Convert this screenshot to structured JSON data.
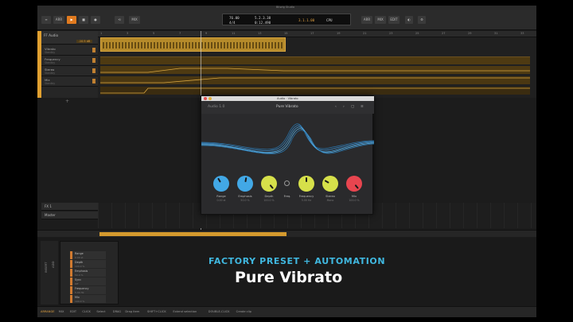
{
  "window": {
    "title": "Bitwig Studio"
  },
  "toolbar": {
    "buttons": [
      "≡",
      "ARR",
      "▶",
      "■",
      "●",
      "⟲",
      "MIX"
    ],
    "right_buttons": [
      "ARR",
      "MIX",
      "EDIT",
      "◐",
      "⚙"
    ]
  },
  "transport": {
    "tempo": "76.00",
    "signature": "4/4",
    "position": "5.2.3.38",
    "time": "0:12.490",
    "bar_readout": "3.1.1.00",
    "cpu": "CPU"
  },
  "ruler": {
    "ticks": [
      "1",
      "3",
      "5",
      "7",
      "9",
      "11",
      "13",
      "15",
      "17",
      "19",
      "21",
      "23",
      "25",
      "27",
      "29",
      "31",
      "33"
    ]
  },
  "tracks": {
    "main": {
      "title": "FF Audio",
      "volume": "-10.5 dB"
    },
    "lanes": [
      {
        "name": "Vibrato",
        "sub": "Standby"
      },
      {
        "name": "Frequency",
        "sub": "Standby"
      },
      {
        "name": "Stereo",
        "sub": "Standby"
      },
      {
        "name": "Mix",
        "sub": "Standby"
      }
    ],
    "lower": [
      {
        "name": "FX 1"
      },
      {
        "name": "Master"
      }
    ]
  },
  "plugin": {
    "window_title": "Audio · Vibrato",
    "brand": "Audio 1.0",
    "preset": "Pure Vibrato",
    "controls": [
      "‹",
      "›",
      "▢",
      "≡"
    ],
    "knobs": [
      {
        "label": "Range",
        "value": "0.00 st",
        "color": "#42a8e6"
      },
      {
        "label": "Emphasis",
        "value": "50.0 %",
        "color": "#42a8e6"
      },
      {
        "label": "Depth",
        "value": "100.0 %",
        "color": "#d6e04a"
      },
      {
        "label": "Freq.",
        "value": "",
        "color": "#cccccc"
      },
      {
        "label": "Frequency",
        "value": "5.00 Hz",
        "color": "#d6e04a"
      },
      {
        "label": "Stereo",
        "value": "Mono",
        "color": "#d6e04a"
      },
      {
        "label": "Mix",
        "value": "100.0 %",
        "color": "#e8454f"
      }
    ]
  },
  "device_panel": {
    "side_labels": [
      "INSERT",
      "ADD"
    ],
    "params": [
      {
        "name": "Range",
        "value": "0.00 st"
      },
      {
        "name": "Depth",
        "value": "100.0 %"
      },
      {
        "name": "Emphasis",
        "value": "50.0 %"
      },
      {
        "name": "Sync",
        "value": "Off"
      },
      {
        "name": "Frequency",
        "value": "5.00 Hz"
      },
      {
        "name": "Mix",
        "value": "100.0 %"
      }
    ]
  },
  "promo": {
    "subtitle": "FACTORY PRESET + AUTOMATION",
    "title": "Pure Vibrato"
  },
  "statusbar": {
    "items": [
      "ARRANGE",
      "MIX",
      "EDIT",
      "CLICK",
      "Select",
      "DRAG",
      "Drag item",
      "SHIFT+CLICK",
      "Extend selection",
      "DOUBLE-CLICK",
      "Create clip"
    ]
  },
  "colors": {
    "accent": "#e07a1f",
    "clip": "#b58a2a",
    "promo_sub": "#40b8e0"
  }
}
